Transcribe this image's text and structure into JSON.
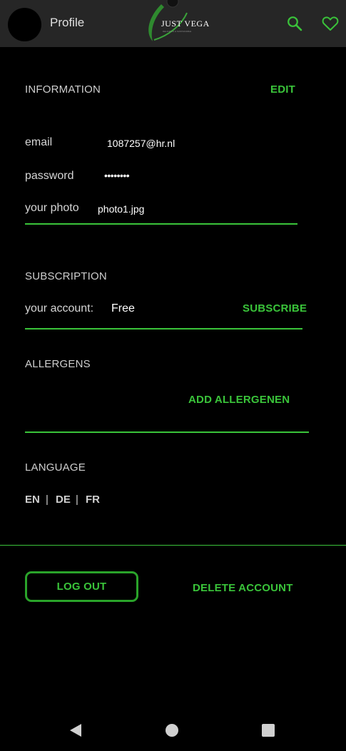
{
  "header": {
    "title": "Profile",
    "logo_text": "JUST VEGA",
    "logo_tagline": "DELICIOUS & SUSTAINABLE",
    "icons": [
      "search-icon",
      "heart-icon"
    ]
  },
  "information": {
    "title": "INFORMATION",
    "edit_label": "EDIT",
    "email_label": "email",
    "email_value": "1087257@hr.nl",
    "password_label": "password",
    "password_value": "••••••••",
    "photo_label": "your photo",
    "photo_value": "photo1.jpg"
  },
  "subscription": {
    "title": "SUBSCRIPTION",
    "account_label": "your account:",
    "account_value": "Free",
    "subscribe_label": "SUBSCRIBE"
  },
  "allergens": {
    "title": "ALLERGENS",
    "add_label": "ADD ALLERGENEN"
  },
  "language": {
    "title": "LANGUAGE",
    "options": [
      "EN",
      "DE",
      "FR"
    ],
    "separator": "|"
  },
  "actions": {
    "logout_label": "LOG OUT",
    "delete_label": "DELETE ACCOUNT"
  },
  "colors": {
    "accent": "#3ac43a",
    "background": "#000000",
    "topbar": "#262626"
  }
}
